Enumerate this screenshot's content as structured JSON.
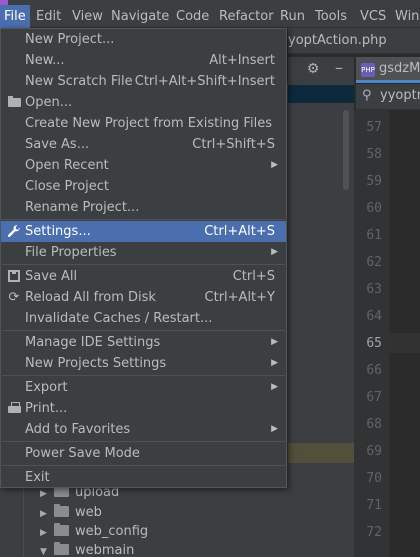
{
  "menubar": {
    "items": [
      {
        "label": "File",
        "active": true
      },
      {
        "label": "Edit"
      },
      {
        "label": "View"
      },
      {
        "label": "Navigate"
      },
      {
        "label": "Code"
      },
      {
        "label": "Refactor"
      },
      {
        "label": "Run"
      },
      {
        "label": "Tools"
      },
      {
        "label": "VCS"
      },
      {
        "label": "Windo"
      }
    ]
  },
  "editor": {
    "tab_partial": "yoptAction.php",
    "file_tab": "gsdzM",
    "file_tab_icon": "PHP",
    "search_text": "yyoptr",
    "line_numbers": [
      "57",
      "58",
      "59",
      "60",
      "61",
      "62",
      "63",
      "64",
      "65",
      "66",
      "67",
      "68",
      "69",
      "70",
      "71",
      "72"
    ],
    "current_line": "65"
  },
  "project_tree": {
    "items": [
      {
        "label": "upload",
        "arrow": "▶"
      },
      {
        "label": "web",
        "arrow": "▶"
      },
      {
        "label": "web_config",
        "arrow": "▶"
      },
      {
        "label": "webmain",
        "arrow": "▼"
      }
    ]
  },
  "file_menu": {
    "items": [
      {
        "label": "New Project...",
        "shortcut": ""
      },
      {
        "label": "New...",
        "shortcut": "Alt+Insert"
      },
      {
        "label": "New Scratch File",
        "shortcut": "Ctrl+Alt+Shift+Insert"
      },
      {
        "label": "Open...",
        "shortcut": "",
        "icon": "folder-icon"
      },
      {
        "label": "Create New Project from Existing Files",
        "shortcut": ""
      },
      {
        "label": "Save As...",
        "shortcut": "Ctrl+Shift+S"
      },
      {
        "label": "Open Recent",
        "shortcut": "",
        "submenu": true
      },
      {
        "label": "Close Project",
        "shortcut": ""
      },
      {
        "label": "Rename Project...",
        "shortcut": ""
      },
      {
        "label": "Settings...",
        "shortcut": "Ctrl+Alt+S",
        "icon": "wrench-icon",
        "selected": true
      },
      {
        "label": "File Properties",
        "shortcut": "",
        "submenu": true
      },
      {
        "label": "Save All",
        "shortcut": "Ctrl+S",
        "icon": "save-icon"
      },
      {
        "label": "Reload All from Disk",
        "shortcut": "Ctrl+Alt+Y",
        "icon": "reload-icon"
      },
      {
        "label": "Invalidate Caches / Restart...",
        "shortcut": ""
      },
      {
        "label": "Manage IDE Settings",
        "shortcut": "",
        "submenu": true
      },
      {
        "label": "New Projects Settings",
        "shortcut": "",
        "submenu": true
      },
      {
        "label": "Export",
        "shortcut": "",
        "submenu": true
      },
      {
        "label": "Print...",
        "shortcut": "",
        "icon": "print-icon"
      },
      {
        "label": "Add to Favorites",
        "shortcut": "",
        "submenu": true
      },
      {
        "label": "Power Save Mode",
        "shortcut": ""
      },
      {
        "label": "Exit",
        "shortcut": ""
      }
    ]
  },
  "colors": {
    "menu_bg": "#3c3f41",
    "selection": "#4b6eaf",
    "editor_bg": "#2b2b2b",
    "gutter_bg": "#313335"
  }
}
